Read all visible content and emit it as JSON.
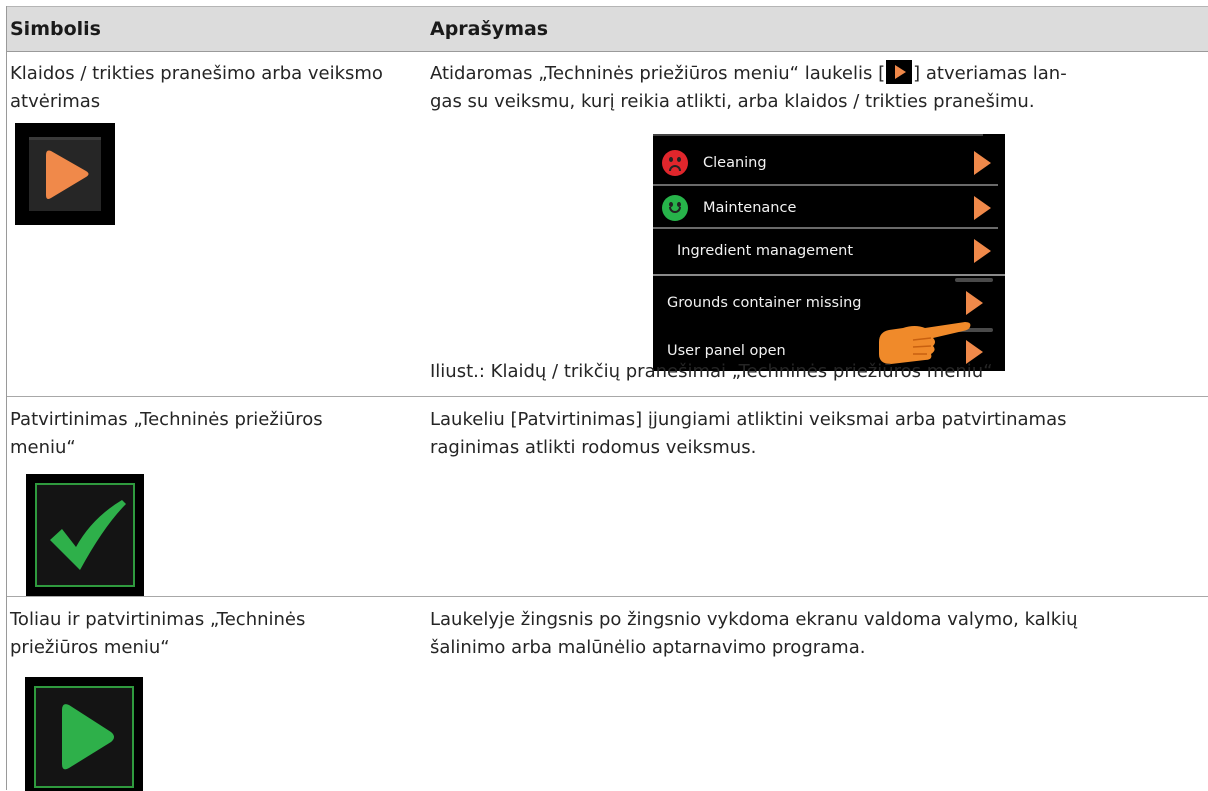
{
  "header": {
    "col1": "Simbolis",
    "col2": "Aprašymas"
  },
  "rows": [
    {
      "symbol_text": "Klaidos / trikties pranešimo arba veiksmo atvėrimas",
      "icon": "orange-play-arrow-icon",
      "description_before": "Atidaromas „Techninės priežiūros meniu“ laukelis [",
      "description_after": "] atveriamas langas su veiksmu, kurį reikia atlikti, arba klaidos / trikties pranešimu.",
      "description_line1_prefix": "Atidaromas „Techninės priežiūros meniu“ laukelis [",
      "description_line1_suffix": "] atveriamas lan-",
      "description_line2": "gas su veiksmu, kurį reikia atlikti, arba klaidos / trikties pranešimu.",
      "screenshot": {
        "items": [
          {
            "label": "Cleaning",
            "status": "sad-face-icon"
          },
          {
            "label": "Maintenance",
            "status": "happy-face-icon"
          },
          {
            "label": "Ingredient management",
            "status": ""
          },
          {
            "label": "Grounds container missing",
            "status": ""
          },
          {
            "label": "User panel open",
            "status": ""
          }
        ]
      },
      "caption": "Iliust.: Klaidų / trikčių pranešimai „Techninės priežiūros meniu“"
    },
    {
      "symbol_line1": "Patvirtinimas „Techninės priežiūros",
      "symbol_line2": "meniu“",
      "icon": "green-checkmark-icon",
      "desc_line1": "Laukeliu [Patvirtinimas] įjungiami atliktini veiksmai arba patvirtinamas",
      "desc_line2": "raginimas atlikti rodomus veiksmus."
    },
    {
      "symbol_line1": "Toliau ir patvirtinimas „Techninės",
      "symbol_line2": "priežiūros meniu“",
      "icon": "green-play-arrow-icon",
      "desc_line1": "Laukelyje žingsnis po žingsnio vykdoma ekranu valdoma valymo, kalkių",
      "desc_line2": "šalinimo arba malūnėlio aptarnavimo programa."
    }
  ],
  "colors": {
    "header_bg": "#dcdcdc",
    "orange_arrow": "#f0894a",
    "green_icon": "#2eb04a",
    "sad_face": "#e0262c",
    "happy_face": "#27b34a",
    "pointer_hand": "#f08a2a"
  }
}
